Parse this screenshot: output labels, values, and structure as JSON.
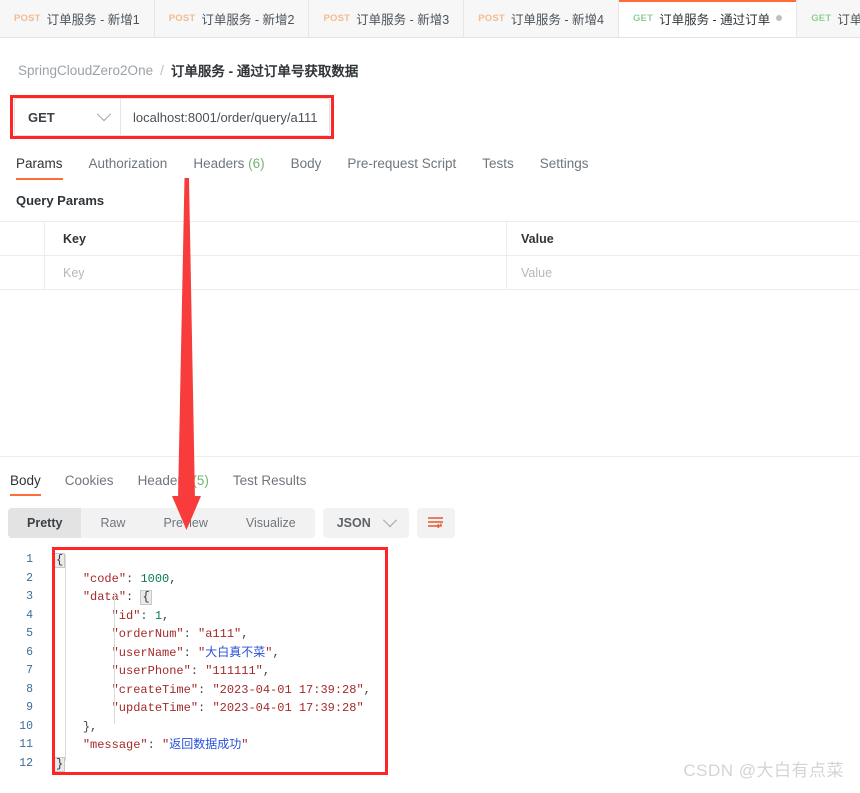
{
  "tabs": [
    {
      "method": "POST",
      "title": "订单服务 - 新增1",
      "active": false,
      "dirty": false
    },
    {
      "method": "POST",
      "title": "订单服务 - 新增2",
      "active": false,
      "dirty": false
    },
    {
      "method": "POST",
      "title": "订单服务 - 新增3",
      "active": false,
      "dirty": false
    },
    {
      "method": "POST",
      "title": "订单服务 - 新增4",
      "active": false,
      "dirty": false
    },
    {
      "method": "GET",
      "title": "订单服务 - 通过订单",
      "active": true,
      "dirty": true
    },
    {
      "method": "GET",
      "title": "订单服务 - 通过用户",
      "active": false,
      "dirty": true
    }
  ],
  "breadcrumb": {
    "collection": "SpringCloudZero2One",
    "separator": "/",
    "current": "订单服务 - 通过订单号获取数据"
  },
  "urlbar": {
    "method": "GET",
    "url": "localhost:8001/order/query/a111"
  },
  "request_tabs": [
    {
      "label": "Params",
      "active": true
    },
    {
      "label": "Authorization",
      "active": false
    },
    {
      "label": "Headers",
      "count": "(6)",
      "active": false
    },
    {
      "label": "Body",
      "active": false
    },
    {
      "label": "Pre-request Script",
      "active": false
    },
    {
      "label": "Tests",
      "active": false
    },
    {
      "label": "Settings",
      "active": false
    }
  ],
  "query_params": {
    "section_label": "Query Params",
    "headers": {
      "key": "Key",
      "value": "Value"
    },
    "rows": [
      {
        "key_placeholder": "Key",
        "value_placeholder": "Value"
      }
    ]
  },
  "response_tabs": [
    {
      "label": "Body",
      "active": true
    },
    {
      "label": "Cookies",
      "active": false
    },
    {
      "label": "Headers",
      "count": "(5)",
      "active": false
    },
    {
      "label": "Test Results",
      "active": false
    }
  ],
  "format_bar": {
    "segments": [
      {
        "label": "Pretty",
        "active": true
      },
      {
        "label": "Raw",
        "active": false
      },
      {
        "label": "Preview",
        "active": false
      },
      {
        "label": "Visualize",
        "active": false
      }
    ],
    "language": "JSON",
    "wrap_icon": "word-wrap-icon"
  },
  "response_body": {
    "lines": [
      {
        "n": "1",
        "text": "{"
      },
      {
        "n": "2",
        "text": "    \"code\": 1000,"
      },
      {
        "n": "3",
        "text": "    \"data\": {"
      },
      {
        "n": "4",
        "text": "        \"id\": 1,"
      },
      {
        "n": "5",
        "text": "        \"orderNum\": \"a111\","
      },
      {
        "n": "6",
        "text": "        \"userName\": \"大白真不菜\","
      },
      {
        "n": "7",
        "text": "        \"userPhone\": \"111111\","
      },
      {
        "n": "8",
        "text": "        \"createTime\": \"2023-04-01 17:39:28\","
      },
      {
        "n": "9",
        "text": "        \"updateTime\": \"2023-04-01 17:39:28\""
      },
      {
        "n": "10",
        "text": "    },"
      },
      {
        "n": "11",
        "text": "    \"message\": \"返回数据成功\""
      },
      {
        "n": "12",
        "text": "}"
      }
    ],
    "parsed": {
      "code": 1000,
      "data": {
        "id": 1,
        "orderNum": "a111",
        "userName": "大白真不菜",
        "userPhone": "111111",
        "createTime": "2023-04-01 17:39:28",
        "updateTime": "2023-04-01 17:39:28"
      },
      "message": "返回数据成功"
    }
  },
  "annotations": {
    "highlight_color": "#fc2626",
    "arrow_color": "#f83b3b"
  },
  "watermark": "CSDN @大白有点菜"
}
